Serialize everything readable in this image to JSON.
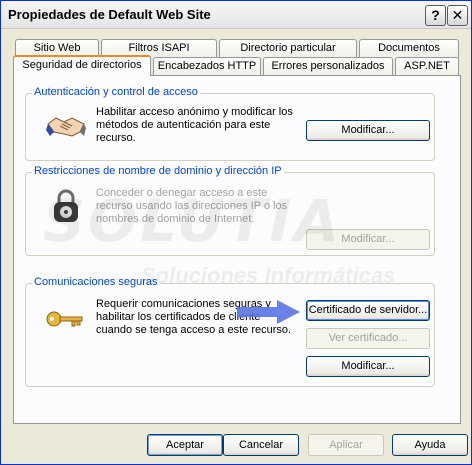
{
  "window": {
    "title": "Propiedades de Default Web Site",
    "help_glyph": "?",
    "close_glyph": "✕"
  },
  "tabs_row1": [
    "Sitio Web",
    "Filtros ISAPI",
    "Directorio particular",
    "Documentos"
  ],
  "tabs_row2": [
    "Seguridad de directorios",
    "Encabezados HTTP",
    "Errores personalizados",
    "ASP.NET"
  ],
  "active_tab": "Seguridad de directorios",
  "groups": {
    "auth": {
      "title": "Autenticación y control de acceso",
      "description": "Habilitar acceso anónimo y modificar los métodos de autenticación para este recurso.",
      "button": "Modificar...",
      "icon": "handshake-icon"
    },
    "ip": {
      "title": "Restricciones de nombre de dominio y dirección IP",
      "description": "Conceder o denegar acceso a este recurso usando las direcciones IP o los nombres de dominio de Internet.",
      "button": "Modificar...",
      "icon": "padlock-icon"
    },
    "secure": {
      "title": "Comunicaciones seguras",
      "description": "Requerir comunicaciones seguras y habilitar los certificados de cliente cuando se tenga acceso a este recurso.",
      "button_cert": "Certificado de servidor...",
      "button_view": "Ver certificado...",
      "button_modify": "Modificar...",
      "icon": "key-icon"
    }
  },
  "watermark": {
    "brand": "SOLUTIA",
    "tagline": "Soluciones Informáticas"
  },
  "footer": {
    "accept": "Aceptar",
    "cancel": "Cancelar",
    "apply": "Aplicar",
    "help": "Ayuda"
  },
  "colors": {
    "accent_blue": "#0046d5",
    "arrow_blue": "#5b73e8",
    "tab_highlight": "#e68b2c"
  }
}
